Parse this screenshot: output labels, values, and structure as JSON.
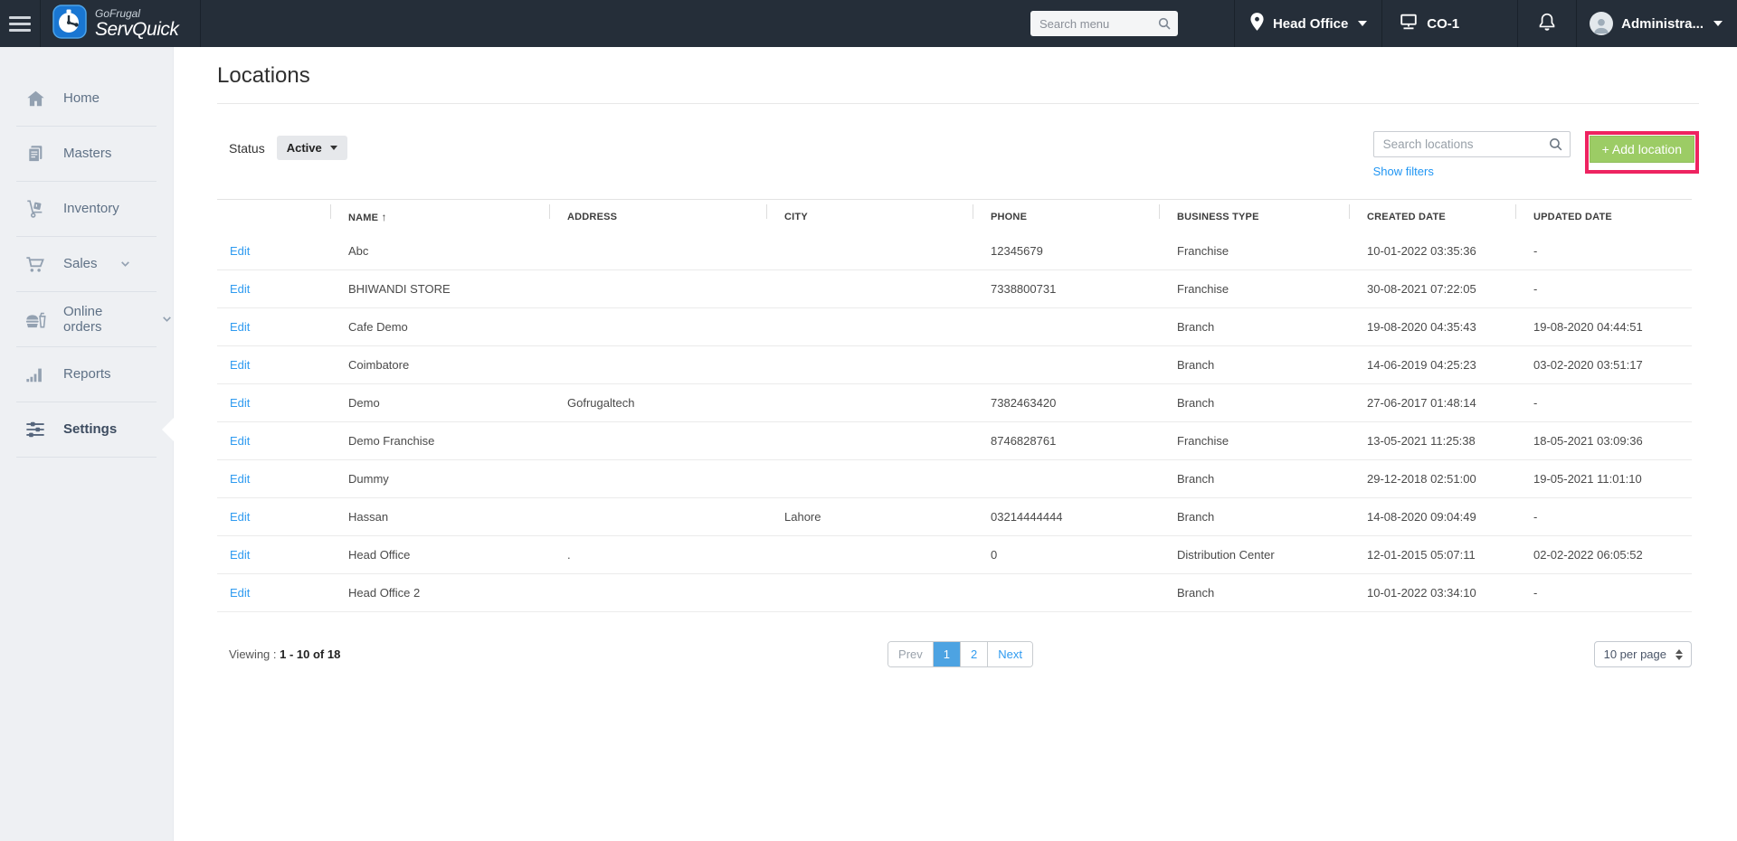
{
  "topbar": {
    "brand_top": "GoFrugal",
    "brand_bottom": "ServQuick",
    "menu_search_placeholder": "Search menu",
    "location_name": "Head Office",
    "terminal_name": "CO-1",
    "user_name": "Administra..."
  },
  "sidebar": {
    "items": [
      {
        "label": "Home",
        "icon": "home-icon",
        "expandable": false,
        "active": false
      },
      {
        "label": "Masters",
        "icon": "masters-icon",
        "expandable": false,
        "active": false
      },
      {
        "label": "Inventory",
        "icon": "inventory-icon",
        "expandable": false,
        "active": false
      },
      {
        "label": "Sales",
        "icon": "sales-cart-icon",
        "expandable": true,
        "active": false
      },
      {
        "label": "Online orders",
        "icon": "online-orders-icon",
        "expandable": true,
        "active": false
      },
      {
        "label": "Reports",
        "icon": "reports-icon",
        "expandable": false,
        "active": false
      },
      {
        "label": "Settings",
        "icon": "settings-sliders-icon",
        "expandable": false,
        "active": true
      }
    ]
  },
  "page": {
    "title": "Locations",
    "status_label": "Status",
    "status_value": "Active",
    "search_placeholder": "Search locations",
    "add_location_label": "+ Add location",
    "show_filters_label": "Show filters"
  },
  "table": {
    "edit_label": "Edit",
    "sort_icon": "↑",
    "columns": [
      {
        "label": ""
      },
      {
        "label": "NAME",
        "sorted": true
      },
      {
        "label": "ADDRESS"
      },
      {
        "label": "CITY"
      },
      {
        "label": "PHONE"
      },
      {
        "label": "BUSINESS TYPE"
      },
      {
        "label": "CREATED DATE"
      },
      {
        "label": "UPDATED DATE"
      }
    ],
    "rows": [
      {
        "name": "Abc",
        "address": "",
        "city": "",
        "phone": "12345679",
        "business_type": "Franchise",
        "created_date": "10-01-2022 03:35:36",
        "updated_date": "-"
      },
      {
        "name": "BHIWANDI STORE",
        "address": "",
        "city": "",
        "phone": "7338800731",
        "business_type": "Franchise",
        "created_date": "30-08-2021 07:22:05",
        "updated_date": "-"
      },
      {
        "name": "Cafe Demo",
        "address": "",
        "city": "",
        "phone": "",
        "business_type": "Branch",
        "created_date": "19-08-2020 04:35:43",
        "updated_date": "19-08-2020 04:44:51"
      },
      {
        "name": "Coimbatore",
        "address": "",
        "city": "",
        "phone": "",
        "business_type": "Branch",
        "created_date": "14-06-2019 04:25:23",
        "updated_date": "03-02-2020 03:51:17"
      },
      {
        "name": "Demo",
        "address": "Gofrugaltech",
        "city": "",
        "phone": "7382463420",
        "business_type": "Branch",
        "created_date": "27-06-2017 01:48:14",
        "updated_date": "-"
      },
      {
        "name": "Demo Franchise",
        "address": "",
        "city": "",
        "phone": "8746828761",
        "business_type": "Franchise",
        "created_date": "13-05-2021 11:25:38",
        "updated_date": "18-05-2021 03:09:36"
      },
      {
        "name": "Dummy",
        "address": "",
        "city": "",
        "phone": "",
        "business_type": "Branch",
        "created_date": "29-12-2018 02:51:00",
        "updated_date": "19-05-2021 11:01:10"
      },
      {
        "name": "Hassan",
        "address": "",
        "city": "Lahore",
        "phone": "03214444444",
        "business_type": "Branch",
        "created_date": "14-08-2020 09:04:49",
        "updated_date": "-"
      },
      {
        "name": "Head Office",
        "address": ".",
        "city": "",
        "phone": "0",
        "business_type": "Distribution Center",
        "created_date": "12-01-2015 05:07:11",
        "updated_date": "02-02-2022 06:05:52"
      },
      {
        "name": "Head Office 2",
        "address": "",
        "city": "",
        "phone": "",
        "business_type": "Branch",
        "created_date": "10-01-2022 03:34:10",
        "updated_date": "-"
      }
    ]
  },
  "footer": {
    "viewing_prefix": "Viewing : ",
    "viewing_range": "1 - 10 of 18",
    "pagination": [
      {
        "label": "Prev",
        "type": "prev",
        "active": false
      },
      {
        "label": "1",
        "type": "page",
        "active": true
      },
      {
        "label": "2",
        "type": "page",
        "active": false
      },
      {
        "label": "Next",
        "type": "next",
        "active": false
      }
    ],
    "per_page": "10 per page"
  },
  "colors": {
    "topbar_bg": "#252e39",
    "sidebar_bg": "#eef0f3",
    "link_blue": "#2196f3",
    "add_button_green": "#9ccc65",
    "highlight_pink": "#ee2360",
    "pagination_active_blue": "#4da3e2"
  }
}
